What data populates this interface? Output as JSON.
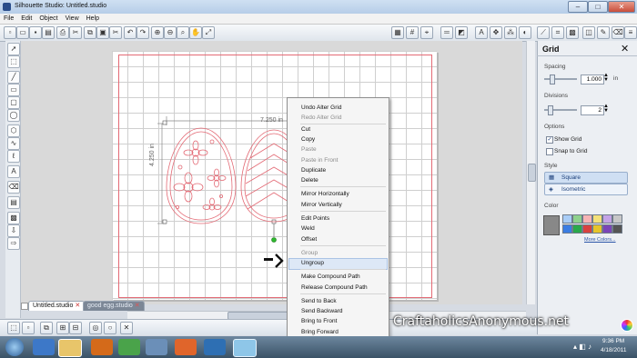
{
  "window": {
    "title": "Silhouette Studio: Untitled.studio"
  },
  "menu": [
    "File",
    "Edit",
    "Object",
    "View",
    "Help"
  ],
  "canvas": {
    "dimension_label": "7.250 in",
    "height_label": "4.250 in"
  },
  "tabs": [
    {
      "label": "Untitled.studio",
      "active": true
    },
    {
      "label": "good egg.studio",
      "active": false
    }
  ],
  "context_menu": {
    "items": [
      {
        "label": "Undo Alter Grid",
        "enabled": true
      },
      {
        "label": "Redo Alter Grid",
        "enabled": false
      },
      {
        "label": "Cut",
        "enabled": true
      },
      {
        "label": "Copy",
        "enabled": true
      },
      {
        "label": "Paste",
        "enabled": false
      },
      {
        "label": "Paste in Front",
        "enabled": false
      },
      {
        "label": "Duplicate",
        "enabled": true
      },
      {
        "label": "Delete",
        "enabled": true
      },
      {
        "label": "Mirror Horizontally",
        "enabled": true
      },
      {
        "label": "Mirror Vertically",
        "enabled": true
      },
      {
        "label": "Edit Points",
        "enabled": true
      },
      {
        "label": "Weld",
        "enabled": true
      },
      {
        "label": "Offset",
        "enabled": true
      },
      {
        "label": "Group",
        "enabled": false
      },
      {
        "label": "Ungroup",
        "enabled": true,
        "highlighted": true
      },
      {
        "label": "Make Compound Path",
        "enabled": true
      },
      {
        "label": "Release Compound Path",
        "enabled": true
      },
      {
        "label": "Send to Back",
        "enabled": true
      },
      {
        "label": "Send Backward",
        "enabled": true
      },
      {
        "label": "Bring to Front",
        "enabled": true
      },
      {
        "label": "Bring Forward",
        "enabled": true
      }
    ]
  },
  "grid_panel": {
    "title": "Grid",
    "spacing_label": "Spacing",
    "spacing_value": "1.000",
    "spacing_unit": "in",
    "divisions_label": "Divisions",
    "divisions_value": "2",
    "options_label": "Options",
    "show_grid_label": "Show Grid",
    "show_grid_checked": true,
    "snap_to_grid_label": "Snap to Grid",
    "snap_to_grid_checked": false,
    "style_label": "Style",
    "style_options": [
      "Square",
      "Isometric"
    ],
    "color_label": "Color",
    "more_colors_label": "More Colors...",
    "selected_color": "#888888",
    "swatches": [
      "#a9cdf7",
      "#8fd18d",
      "#f7b4b4",
      "#f4e17a",
      "#c4a3e6",
      "#c7c7c7",
      "#3b7de3",
      "#2aa84a",
      "#d8413f",
      "#e6c42a",
      "#7b45b8",
      "#555555"
    ]
  },
  "watermark": "CraftaholicsAnonymous.net",
  "clock": {
    "time": "9:36 PM",
    "date": "4/18/2011"
  },
  "colors": {
    "cut_line": "#e36a75",
    "accent": "#3b7de3"
  }
}
